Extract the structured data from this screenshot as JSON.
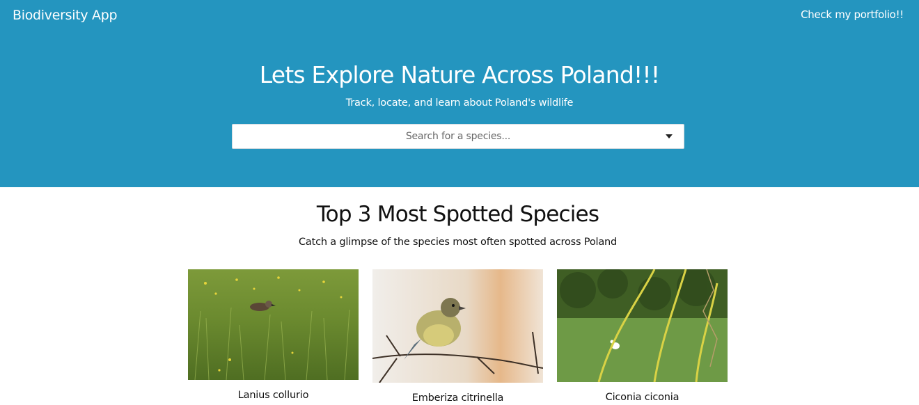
{
  "header": {
    "brand": "Biodiversity App",
    "portfolio_link": "Check my portfolio!!"
  },
  "hero": {
    "title": "Lets Explore Nature Across Poland!!!",
    "subtitle": "Track, locate, and learn about Poland's wildlife",
    "search_placeholder": "Search for a species..."
  },
  "top_species": {
    "title": "Top 3 Most Spotted Species",
    "subtitle": "Catch a glimpse of the species most often spotted across Poland",
    "cards": [
      {
        "name": "Lanius collurio"
      },
      {
        "name": "Emberiza citrinella"
      },
      {
        "name": "Ciconia ciconia"
      }
    ]
  },
  "colors": {
    "hero_bg": "#2495bf",
    "text_dark": "#111111",
    "white": "#ffffff"
  }
}
